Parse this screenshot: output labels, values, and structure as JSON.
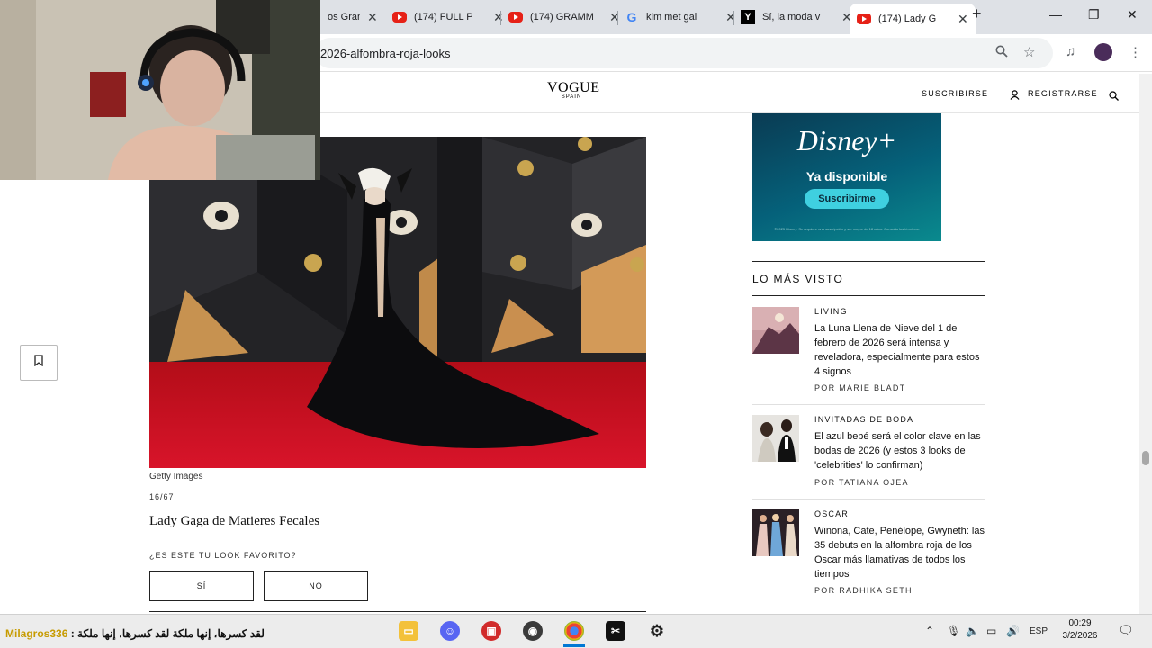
{
  "browser": {
    "tabs": [
      {
        "title": "os Gran",
        "icon": "fire-icon"
      },
      {
        "title": "(174) FULL P",
        "icon": "youtube-icon"
      },
      {
        "title": "(174) GRAMM",
        "icon": "youtube-icon"
      },
      {
        "title": "kim met gal",
        "icon": "google-icon"
      },
      {
        "title": "Sí, la moda v",
        "icon": "yahoo-icon"
      },
      {
        "title": "(174) Lady G",
        "icon": "youtube-icon"
      }
    ],
    "new_tab": "+",
    "url": "2026-alfombra-roja-looks"
  },
  "site": {
    "logo": "VOGUE",
    "logo_sub": "SPAIN",
    "subscribe": "SUSCRIBIRSE",
    "register": "REGISTRARSE"
  },
  "gallery": {
    "credit": "Getty Images",
    "counter": "16/67",
    "title": "Lady Gaga de Matieres Fecales",
    "question": "¿ES ESTE TU LOOK FAVORITO?",
    "yes": "SÍ",
    "no": "NO"
  },
  "ad": {
    "brand": "Disney+",
    "tagline": "Ya disponible",
    "cta": "Suscribirme",
    "fine_print": "©2025 Disney. Se requiere una suscripción y ser mayor de 18 años. Consulta los términos."
  },
  "most_viewed": {
    "title": "LO MÁS VISTO",
    "items": [
      {
        "category": "LIVING",
        "headline": "La Luna Llena de Nieve del 1 de febrero de 2026 será intensa y reveladora, especialmente para estos 4 signos",
        "author": "POR MARIE BLADT"
      },
      {
        "category": "INVITADAS DE BODA",
        "headline": "El azul bebé será el color clave en las bodas de 2026 (y estos 3 looks de 'celebrities' lo confirman)",
        "author": "POR TATIANA OJEA"
      },
      {
        "category": "OSCAR",
        "headline": "Winona, Cate, Penélope, Gwyneth: las 35 debuts en la alfombra roja de los Oscar más llamativas de todos los tiempos",
        "author": "POR RADHIKA SETH"
      }
    ]
  },
  "taskbar": {
    "ticker_user": "Milagros336",
    "ticker_text": " : لقد كسرها، إنها ملكة لقد كسرها، إنها ملكة",
    "lang": "ESP",
    "time": "00:29",
    "date": "3/2/2026"
  },
  "colors": {
    "accent_ad": "#3fd0e0",
    "carpet_red": "#c8101e",
    "tab_strip": "#dee1e6"
  }
}
